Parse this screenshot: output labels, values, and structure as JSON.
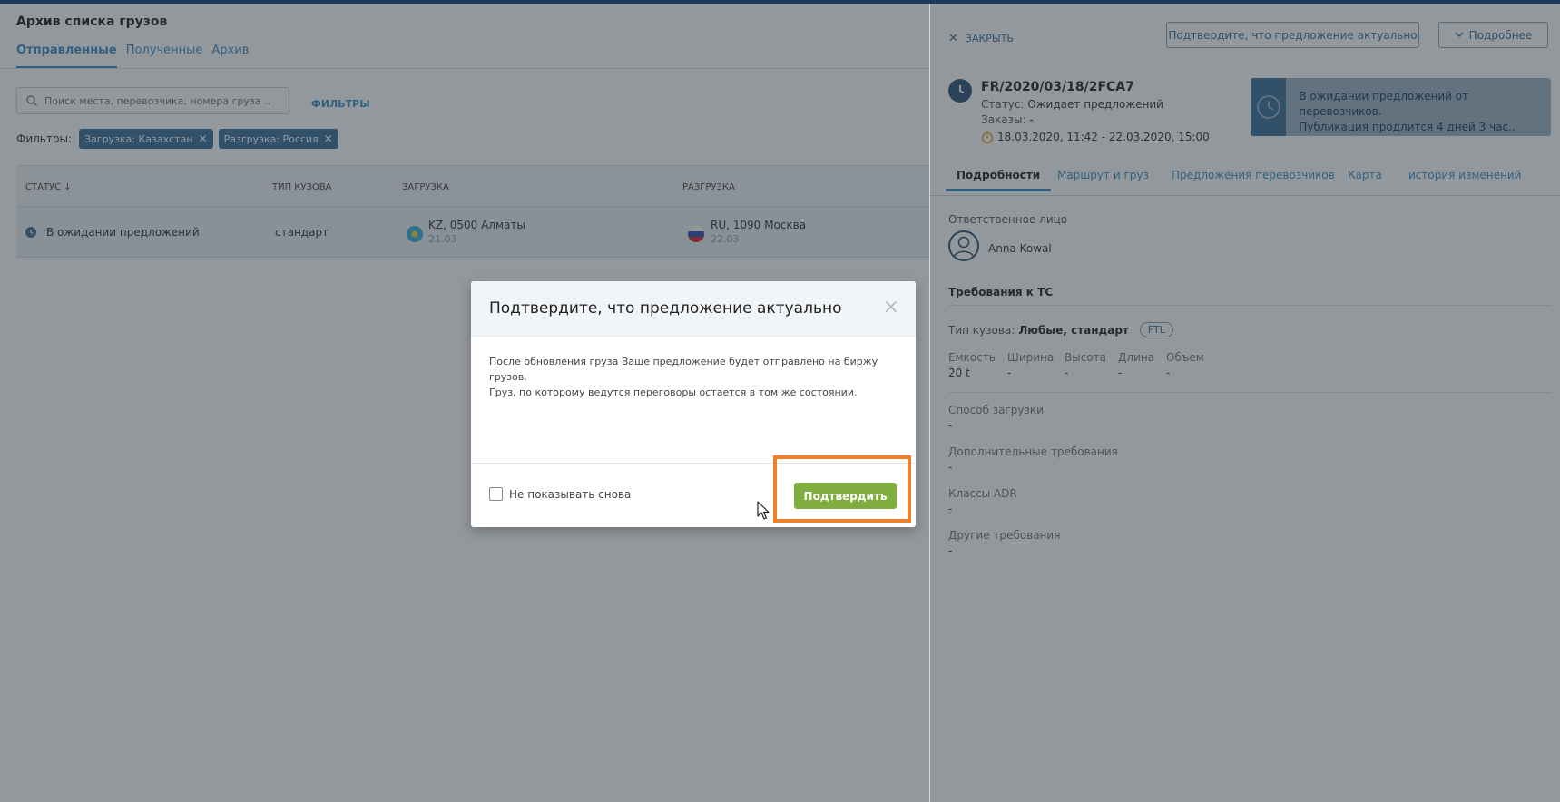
{
  "page": {
    "title": "Архив списка грузов",
    "tabs": [
      "Отправленные",
      "Полученные",
      "Архив"
    ],
    "search_placeholder": "Поиск места, перевозчика, номера груза ...",
    "filters_button": "ФИЛЬТРЫ",
    "filters_label": "Фильтры:",
    "chips": [
      "Загрузка: Казахстан",
      "Разгрузка: Россия"
    ]
  },
  "table": {
    "headers": {
      "status": "СТАТУС ↓",
      "body": "ТИП КУЗОВА",
      "load": "ЗАГРУЗКА",
      "unload": "РАЗГРУЗКА"
    },
    "row": {
      "status": "В ожидании предложений",
      "body": "стандарт",
      "load_place": "KZ, 0500 Алматы",
      "load_date": "21.03",
      "unload_place": "RU, 1090 Москва",
      "unload_date": "22.03"
    }
  },
  "panel": {
    "close": "ЗАКРЫТЬ",
    "confirm_button": "Подтвердите, что предложение актуально",
    "more_button": "Подробнее",
    "cargo_id": "FR/2020/03/18/2FCA7",
    "status_label": "Статус:",
    "status_value": "Ожидает предложений",
    "orders_label": "Заказы:",
    "orders_value": "-",
    "dates": "18.03.2020, 11:42 - 22.03.2020, 15:00",
    "info_line1": "В ожидании предложений от перевозчиков.",
    "info_line2": "Публикация продлится 4 дней 3 час..",
    "tabs": [
      "Подробности",
      "Маршрут и груз",
      "Предложения перевозчиков",
      "Карта",
      "история изменений"
    ],
    "responsible_label": "Ответственное лицо",
    "responsible_name": "Anna Kowal",
    "requirements_title": "Требования к ТС",
    "body_type_label": "Тип кузова:",
    "body_type_value": "Любые, стандарт",
    "ftl": "FTL",
    "specs": [
      {
        "k": "Емкость",
        "v": "20 t"
      },
      {
        "k": "Ширина",
        "v": "-"
      },
      {
        "k": "Высота",
        "v": "-"
      },
      {
        "k": "Длина",
        "v": "-"
      },
      {
        "k": "Объем",
        "v": "-"
      }
    ],
    "requirements": [
      {
        "k": "Способ загрузки",
        "v": "-"
      },
      {
        "k": "Дополнительные требования",
        "v": "-"
      },
      {
        "k": "Классы ADR",
        "v": "-"
      },
      {
        "k": "Другие требования",
        "v": "-"
      }
    ]
  },
  "modal": {
    "title": "Подтвердите, что предложение актуально",
    "close": "×",
    "text_line1": "После обновления груза Ваше предложение будет отправлено на биржу грузов.",
    "text_line2": "Груз, по которому ведутся переговоры остается в том же состоянии.",
    "checkbox_label": "Не показывать снова",
    "confirm": "Подтвердить"
  },
  "colors": {
    "accent": "#3a8fc2",
    "chip": "#3a6f98",
    "confirm": "#7fae3e",
    "highlight": "#f0802a"
  }
}
